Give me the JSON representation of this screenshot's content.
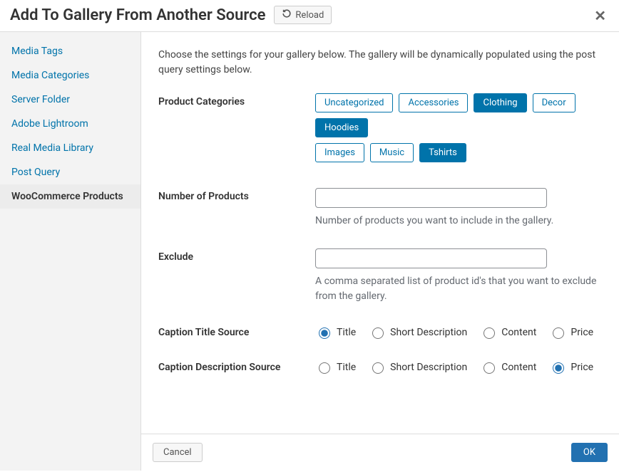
{
  "header": {
    "title": "Add To Gallery From Another Source",
    "reload_label": "Reload"
  },
  "sidebar": {
    "items": [
      {
        "label": "Media Tags",
        "active": false
      },
      {
        "label": "Media Categories",
        "active": false
      },
      {
        "label": "Server Folder",
        "active": false
      },
      {
        "label": "Adobe Lightroom",
        "active": false
      },
      {
        "label": "Real Media Library",
        "active": false
      },
      {
        "label": "Post Query",
        "active": false
      },
      {
        "label": "WooCommerce Products",
        "active": true
      }
    ]
  },
  "main": {
    "intro": "Choose the settings for your gallery below. The gallery will be dynamically populated using the post query settings below.",
    "product_categories_label": "Product Categories",
    "categories": [
      {
        "label": "Uncategorized",
        "selected": false
      },
      {
        "label": "Accessories",
        "selected": false
      },
      {
        "label": "Clothing",
        "selected": true
      },
      {
        "label": "Decor",
        "selected": false
      },
      {
        "label": "Hoodies",
        "selected": true
      },
      {
        "label": "Images",
        "selected": false
      },
      {
        "label": "Music",
        "selected": false
      },
      {
        "label": "Tshirts",
        "selected": true
      }
    ],
    "number_label": "Number of Products",
    "number_value": "",
    "number_help": "Number of products you want to include in the gallery.",
    "exclude_label": "Exclude",
    "exclude_value": "",
    "exclude_help": "A comma separated list of product id's that you want to exclude from the gallery.",
    "caption_title_label": "Caption Title Source",
    "caption_desc_label": "Caption Description Source",
    "caption_options": [
      "Title",
      "Short Description",
      "Content",
      "Price"
    ],
    "caption_title_selected": "Title",
    "caption_desc_selected": "Price"
  },
  "footer": {
    "cancel": "Cancel",
    "ok": "OK"
  }
}
